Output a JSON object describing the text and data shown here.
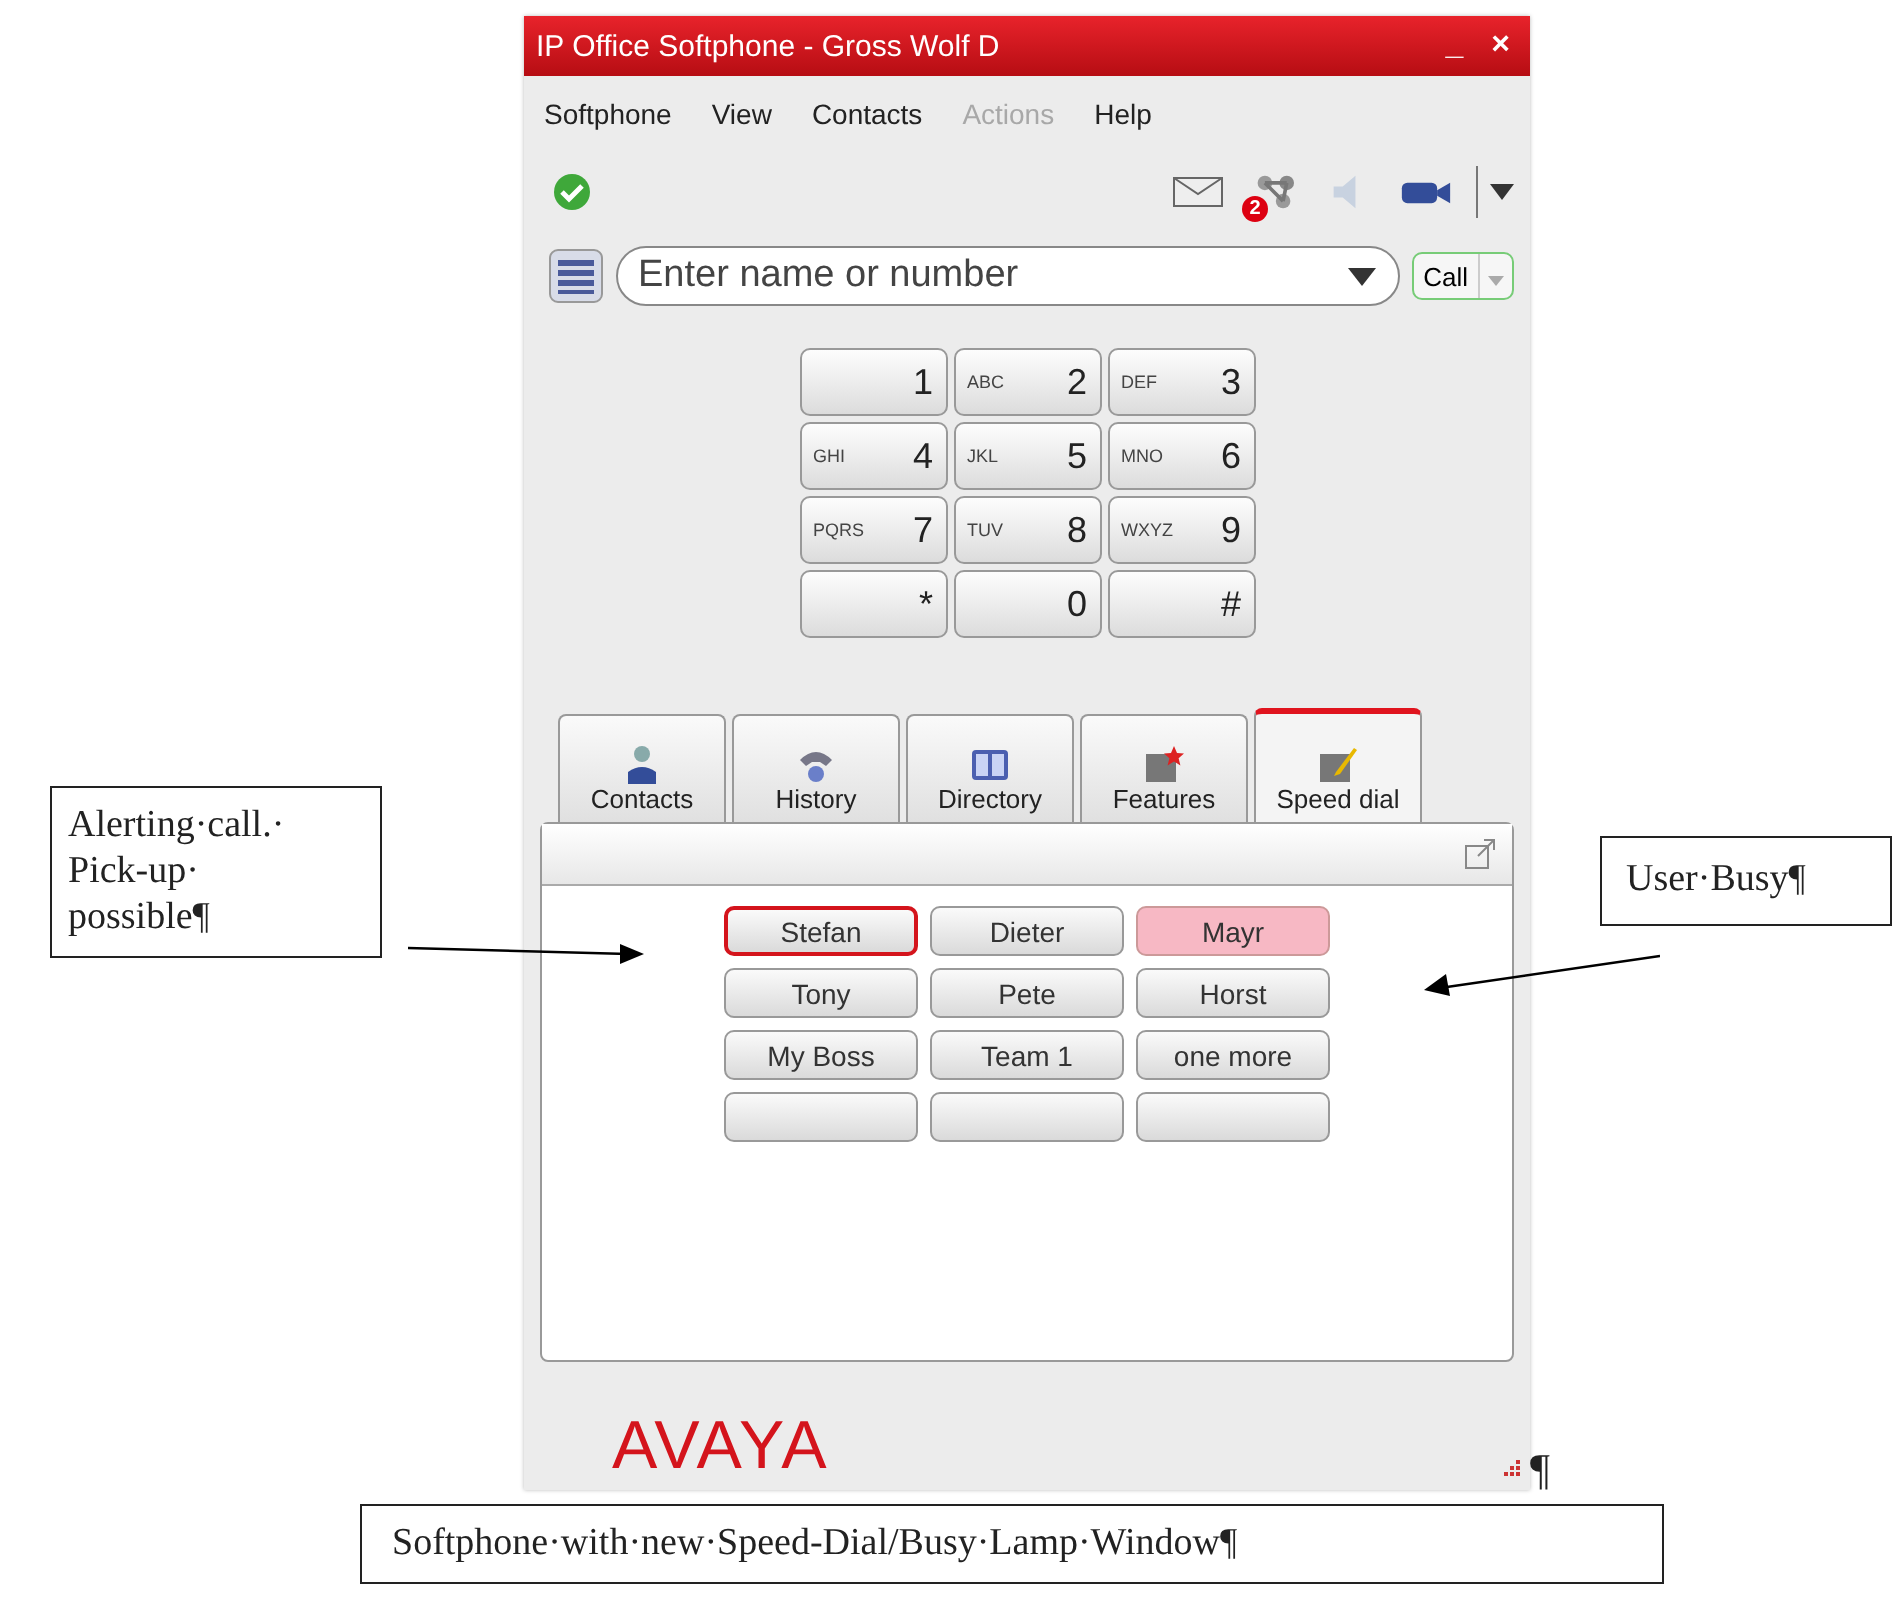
{
  "window": {
    "title": "IP Office Softphone - Gross Wolf D",
    "minimize": "_",
    "close": "×"
  },
  "menu": [
    {
      "label": "Softphone",
      "disabled": false
    },
    {
      "label": "View",
      "disabled": false
    },
    {
      "label": "Contacts",
      "disabled": false
    },
    {
      "label": "Actions",
      "disabled": true
    },
    {
      "label": "Help",
      "disabled": false
    }
  ],
  "status": {
    "online": true
  },
  "toolbar": {
    "missed_badge": "2",
    "speaker_muted": true
  },
  "dial": {
    "placeholder": "Enter name or number",
    "call_button": "Call"
  },
  "keypad": [
    {
      "digit": "1"
    },
    {
      "digit": "2",
      "letters": "ABC"
    },
    {
      "digit": "3",
      "letters": "DEF"
    },
    {
      "digit": "4",
      "letters": "GHI"
    },
    {
      "digit": "5",
      "letters": "JKL"
    },
    {
      "digit": "6",
      "letters": "MNO"
    },
    {
      "digit": "7",
      "letters": "PQRS"
    },
    {
      "digit": "8",
      "letters": "TUV"
    },
    {
      "digit": "9",
      "letters": "WXYZ"
    },
    {
      "digit": "*"
    },
    {
      "digit": "0"
    },
    {
      "digit": "#"
    }
  ],
  "tabs": [
    {
      "label": "Contacts",
      "kind": "person",
      "selected": false
    },
    {
      "label": "History",
      "kind": "phone",
      "selected": false
    },
    {
      "label": "Directory",
      "kind": "book",
      "selected": false
    },
    {
      "label": "Features",
      "kind": "star",
      "selected": false
    },
    {
      "label": "Speed dial",
      "kind": "edit",
      "selected": true
    }
  ],
  "speed_dial": [
    {
      "label": "Stefan",
      "alerting": true,
      "busy": false
    },
    {
      "label": "Dieter",
      "alerting": false,
      "busy": false
    },
    {
      "label": "Mayr",
      "alerting": false,
      "busy": true
    },
    {
      "label": "Tony",
      "alerting": false,
      "busy": false
    },
    {
      "label": "Pete",
      "alerting": false,
      "busy": false
    },
    {
      "label": "Horst",
      "alerting": false,
      "busy": false
    },
    {
      "label": "My Boss",
      "alerting": false,
      "busy": false
    },
    {
      "label": "Team 1",
      "alerting": false,
      "busy": false
    },
    {
      "label": "one more",
      "alerting": false,
      "busy": false
    },
    {
      "alerting": false,
      "busy": false
    },
    {
      "alerting": false,
      "busy": false
    },
    {
      "alerting": false,
      "busy": false
    }
  ],
  "footer": {
    "logo": "AVAYA"
  },
  "pilcrow": "¶",
  "callouts": {
    "left": [
      "Alerting·call.·",
      "Pick-up·",
      "possible¶"
    ],
    "right": "User·Busy¶"
  },
  "caption": "Softphone·with·new·Speed-Dial/Busy·Lamp·Window¶"
}
